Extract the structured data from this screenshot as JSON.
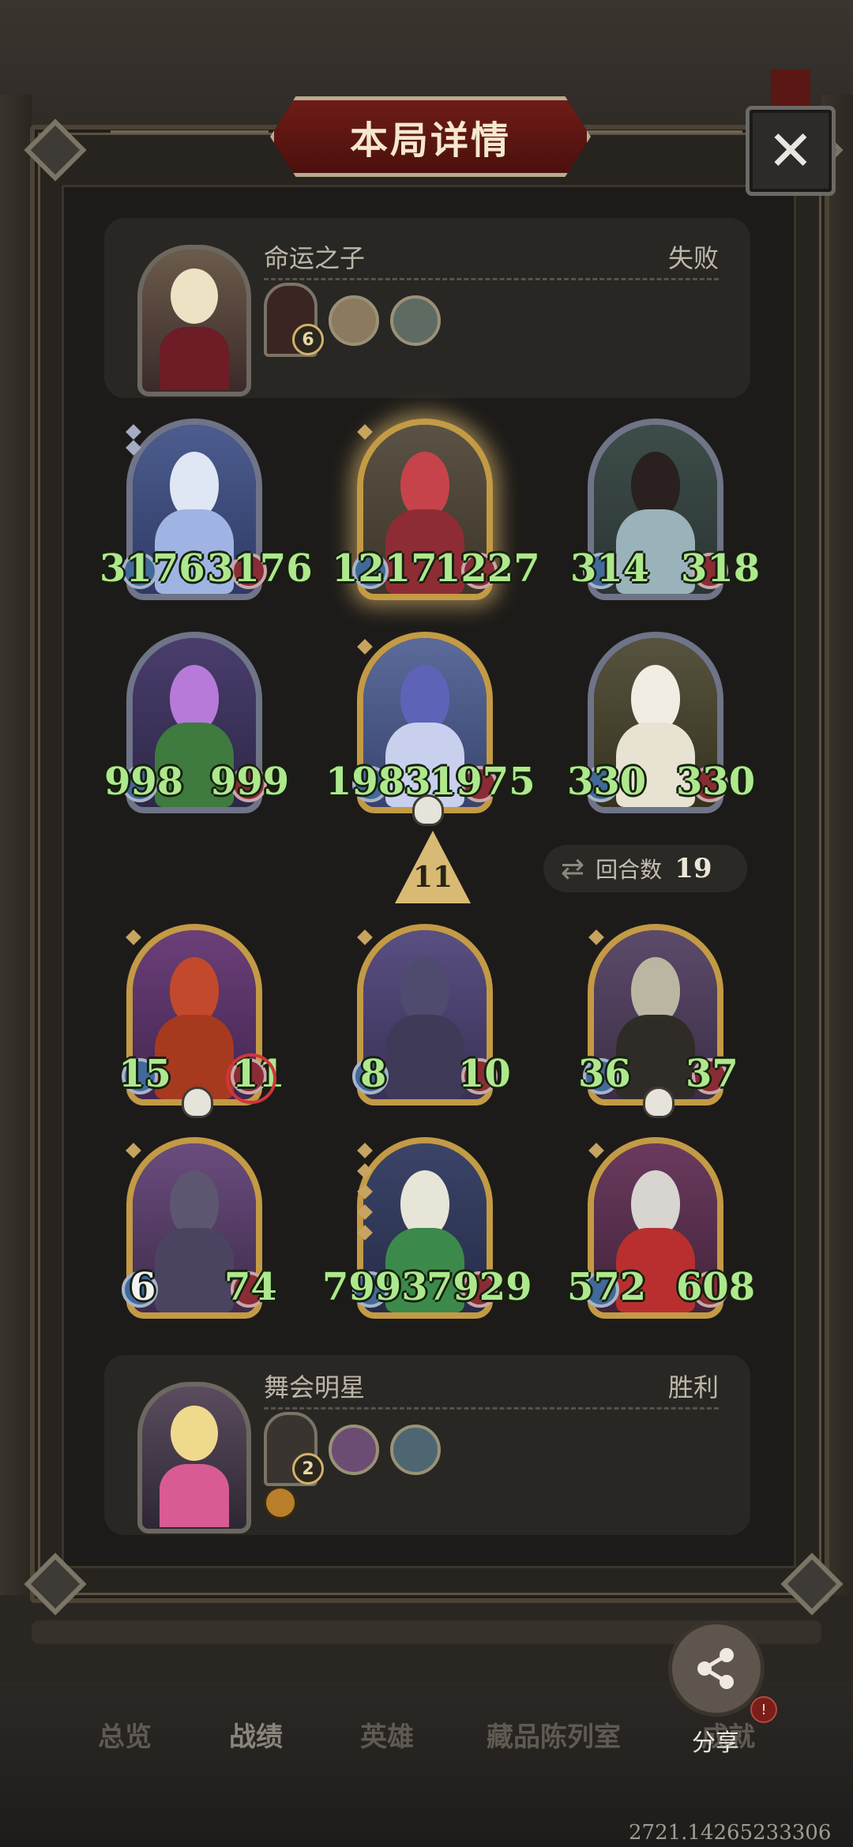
{
  "dialog": {
    "title": "本局详情",
    "close": "✕"
  },
  "top_player": {
    "name": "命运之子",
    "result": "失败",
    "hero_level": "6"
  },
  "bottom_player": {
    "name": "舞会明星",
    "result": "胜利",
    "hero_level": "2"
  },
  "top_board": [
    {
      "attack": "3176",
      "health": "3176"
    },
    {
      "attack": "1217",
      "health": "1227"
    },
    {
      "attack": "314",
      "health": "318"
    },
    {
      "attack": "998",
      "health": "999"
    },
    {
      "attack": "1983",
      "health": "1975"
    },
    {
      "attack": "330",
      "health": "330"
    }
  ],
  "attack_marker": {
    "value": "11"
  },
  "rounds": {
    "label": "回合数",
    "value": "19"
  },
  "bottom_board": [
    {
      "attack": "15",
      "health": "11"
    },
    {
      "attack": "8",
      "health": "10"
    },
    {
      "attack": "36",
      "health": "37"
    },
    {
      "attack": "6",
      "health": "74"
    },
    {
      "attack": "7993",
      "health": "7929"
    },
    {
      "attack": "572",
      "health": "608"
    }
  ],
  "nav": {
    "items": [
      "总览",
      "战绩",
      "英雄",
      "藏品陈列室",
      "成就"
    ],
    "share_label": "分享",
    "share_badge": "!"
  },
  "footer_number": "2721.14265233306"
}
